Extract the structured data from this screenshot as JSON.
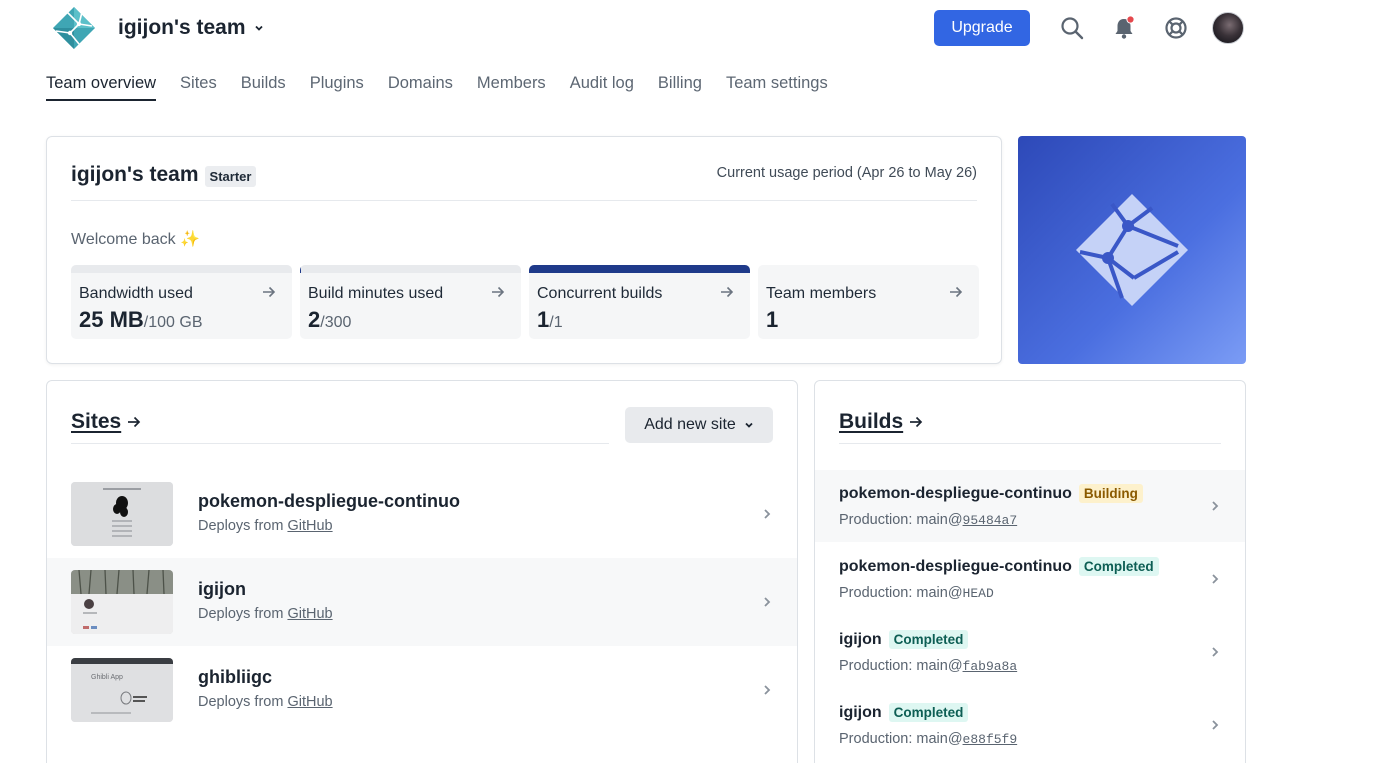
{
  "header": {
    "team_name": "igijon's team",
    "upgrade_label": "Upgrade",
    "icons": [
      "search-icon",
      "bell-icon",
      "help-icon",
      "avatar"
    ],
    "accent_color": "#3266e3",
    "notification_dot_color": "#e5484d"
  },
  "nav": {
    "items": [
      {
        "label": "Team overview",
        "active": true
      },
      {
        "label": "Sites"
      },
      {
        "label": "Builds"
      },
      {
        "label": "Plugins"
      },
      {
        "label": "Domains"
      },
      {
        "label": "Members"
      },
      {
        "label": "Audit log"
      },
      {
        "label": "Billing"
      },
      {
        "label": "Team settings"
      }
    ]
  },
  "overview": {
    "title": "igijon's team",
    "plan": "Starter",
    "usage_period": "Current usage period (Apr 26 to May 26)",
    "welcome": "Welcome back ✨",
    "stats": [
      {
        "label": "Bandwidth used",
        "value": "25 MB",
        "limit": "/100 GB",
        "fill": 0.0
      },
      {
        "label": "Build minutes used",
        "value": "2",
        "limit": "/300",
        "fill": 0.0067
      },
      {
        "label": "Concurrent builds",
        "value": "1",
        "limit": "/1",
        "fill": 1.0
      },
      {
        "label": "Team members",
        "value": "1",
        "limit": ""
      }
    ]
  },
  "sites": {
    "title": "Sites",
    "add_label": "Add new site",
    "items": [
      {
        "name": "pokemon-despliegue-continuo",
        "deploy_prefix": "Deploys from",
        "provider": "GitHub"
      },
      {
        "name": "igijon",
        "deploy_prefix": "Deploys from",
        "provider": "GitHub"
      },
      {
        "name": "ghibliigc",
        "deploy_prefix": "Deploys from",
        "provider": "GitHub",
        "thumb_text": "Ghibli App"
      }
    ]
  },
  "builds": {
    "title": "Builds",
    "items": [
      {
        "name": "pokemon-despliegue-continuo",
        "status": "Building",
        "context": "Production:",
        "branch": "main@",
        "ref": "95484a7",
        "ref_link": true
      },
      {
        "name": "pokemon-despliegue-continuo",
        "status": "Completed",
        "context": "Production:",
        "branch": "main@",
        "ref": "HEAD",
        "ref_link": false
      },
      {
        "name": "igijon",
        "status": "Completed",
        "context": "Production:",
        "branch": "main@",
        "ref": "fab9a8a",
        "ref_link": true
      },
      {
        "name": "igijon",
        "status": "Completed",
        "context": "Production:",
        "branch": "main@",
        "ref": "e88f5f9",
        "ref_link": true
      }
    ]
  }
}
